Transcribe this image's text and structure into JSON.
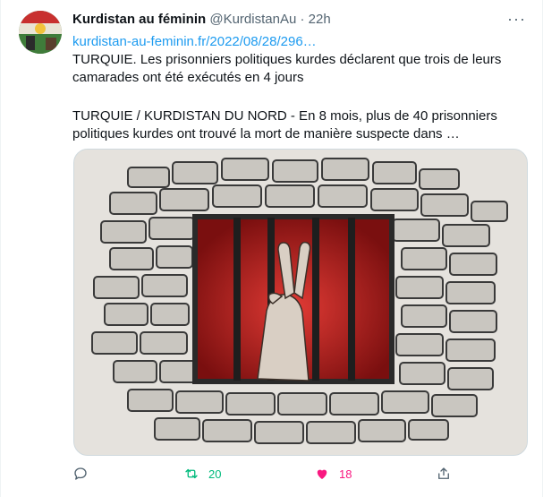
{
  "tweet": {
    "author_name": "Kurdistan au féminin",
    "handle": "@KurdistanAu",
    "separator": "·",
    "time": "22h",
    "more_label": "···",
    "link": "kurdistan-au-feminin.fr/2022/08/28/296…",
    "text_paragraph_1": "TURQUIE. Les prisonniers politiques kurdes déclarent que trois de leurs camarades ont été exécutés en 4 jours",
    "text_paragraph_2": "TURQUIE / KURDISTAN DU NORD - En 8 mois, plus de 40 prisonniers politiques kurdes ont trouvé la mort de manière suspecte dans …"
  },
  "actions": {
    "reply_icon": "reply-icon",
    "retweet_icon": "retweet-icon",
    "retweet_count": "20",
    "like_icon": "heart-filled-icon",
    "like_count": "18",
    "share_icon": "share-icon"
  },
  "colors": {
    "link": "#1d9bf0",
    "retweet": "#00ba7c",
    "like": "#f91880",
    "muted": "#536471"
  }
}
